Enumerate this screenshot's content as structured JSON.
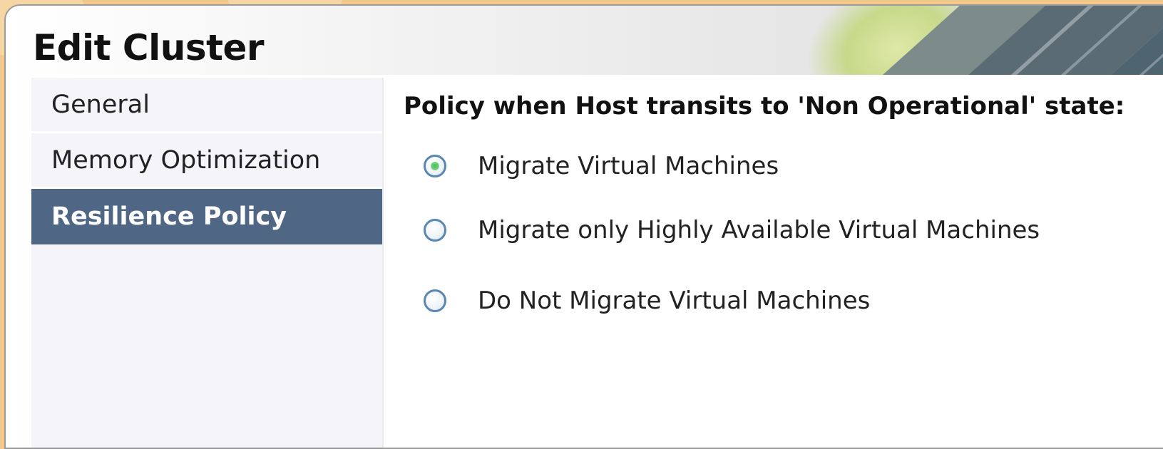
{
  "dialog": {
    "title": "Edit Cluster"
  },
  "sidebar": {
    "items": [
      {
        "label": "General",
        "active": false
      },
      {
        "label": "Memory Optimization",
        "active": false
      },
      {
        "label": "Resilience Policy",
        "active": true
      }
    ]
  },
  "resilience": {
    "heading": "Policy when Host transits to 'Non Operational' state:",
    "options": [
      {
        "label": "Migrate Virtual Machines",
        "selected": true
      },
      {
        "label": "Migrate only Highly Available Virtual Machines",
        "selected": false
      },
      {
        "label": "Do Not Migrate Virtual Machines",
        "selected": false
      }
    ]
  },
  "colors": {
    "active_nav_bg": "#4f6685",
    "radio_border": "#5a86b3",
    "radio_selected_dot": "#3fbf55",
    "backdrop": "#f2c98a"
  }
}
